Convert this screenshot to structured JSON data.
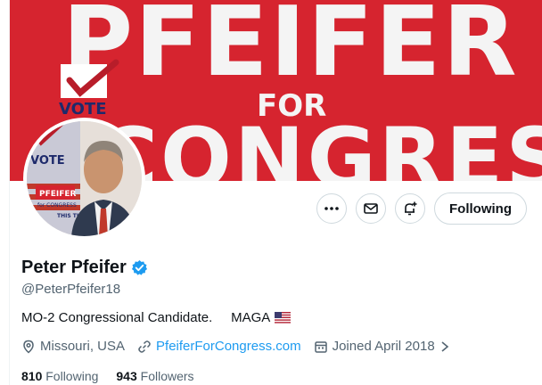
{
  "banner": {
    "line1": "PFEIFER",
    "line2": "FOR",
    "line3": "CONGRESS",
    "vote_label": "VOTE"
  },
  "avatar": {
    "vote_label": "VOTE",
    "name_sign": "PFEIFER",
    "for_sign": "for CONGRESS",
    "date_text": "THIS TUESDAY!! AUG 6"
  },
  "actions": {
    "more_icon": "more-icon",
    "message_icon": "message-icon",
    "notify_icon": "bell-plus-icon",
    "follow_label": "Following"
  },
  "profile": {
    "name": "Peter Pfeifer",
    "handle": "@PeterPfeifer18",
    "bio_text": "MO-2 Congressional Candidate.     MAGA",
    "location": "Missouri, USA",
    "website": "PfeiferForCongress.com",
    "joined": "Joined April 2018",
    "following_count": "810",
    "following_label": "Following",
    "followers_count": "943",
    "followers_label": "Followers"
  },
  "colors": {
    "banner_red": "#d6242f",
    "link_blue": "#1d9bf0",
    "verified_blue": "#1d9bf0",
    "muted_gray": "#536471"
  }
}
